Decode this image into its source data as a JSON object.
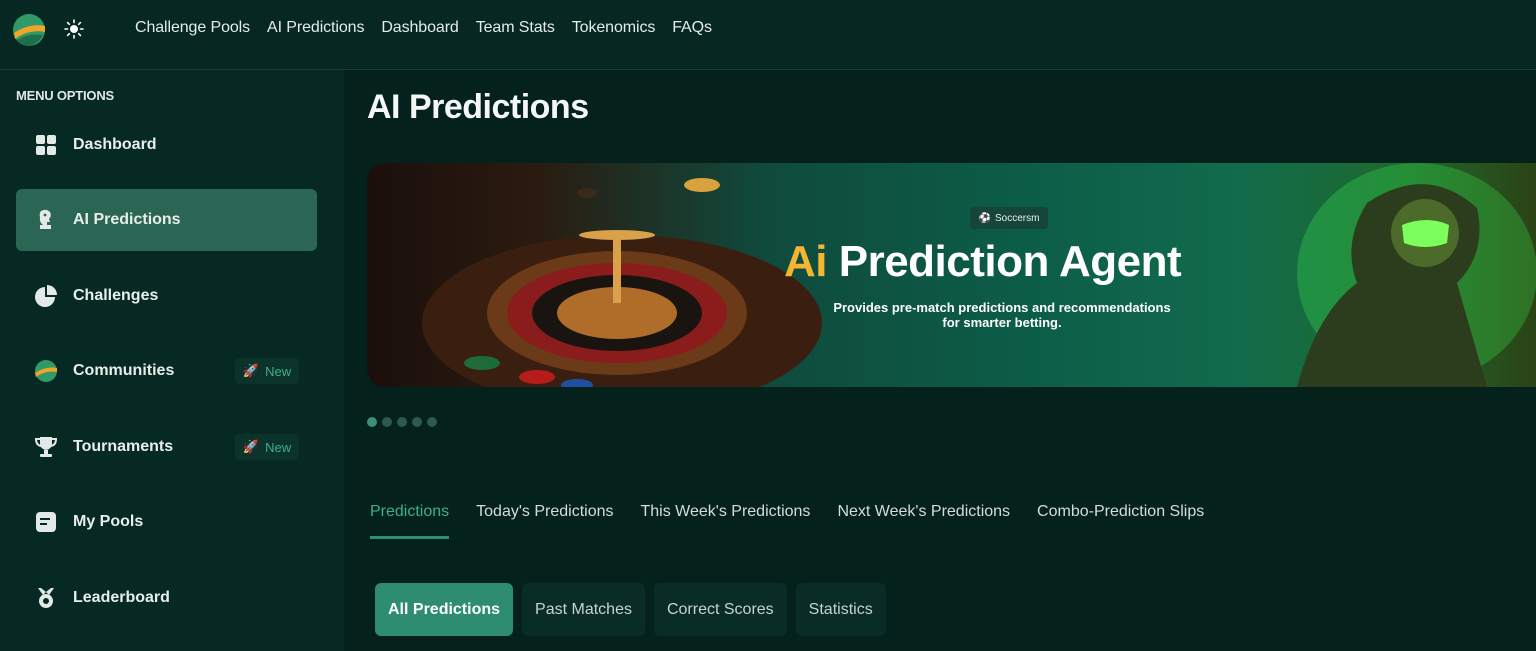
{
  "topbar": {
    "nav": [
      "Challenge Pools",
      "AI Predictions",
      "Dashboard",
      "Team Stats",
      "Tokenomics",
      "FAQs"
    ]
  },
  "sidebar": {
    "title": "MENU OPTIONS",
    "items": [
      {
        "label": "Dashboard",
        "icon": "grid-icon"
      },
      {
        "label": "AI Predictions",
        "icon": "robot-icon",
        "active": true
      },
      {
        "label": "Challenges",
        "icon": "pie-icon"
      },
      {
        "label": "Communities",
        "icon": "ball-icon",
        "badge": "New"
      },
      {
        "label": "Tournaments",
        "icon": "trophy-icon",
        "badge": "New"
      },
      {
        "label": "My Pools",
        "icon": "pool-icon"
      },
      {
        "label": "Leaderboard",
        "icon": "medal-icon"
      }
    ]
  },
  "main": {
    "title": "AI Predictions",
    "banner": {
      "brand": "Soccersm",
      "title_accent": "Ai",
      "title_rest": " Prediction Agent",
      "subtitle_line1": "Provides pre-match predictions and recommendations",
      "subtitle_line2": "for smarter betting."
    },
    "carousel": {
      "count": 5,
      "active_index": 0
    },
    "tabs": [
      "Predictions",
      "Today's Predictions",
      "This Week's Predictions",
      "Next Week's Predictions",
      "Combo-Prediction Slips"
    ],
    "subtabs": [
      "All Predictions",
      "Past Matches",
      "Correct Scores",
      "Statistics"
    ]
  },
  "colors": {
    "background": "#04211b",
    "accent": "#3fb088",
    "active": "#2e8d70",
    "banner_accent": "#f5b533"
  }
}
